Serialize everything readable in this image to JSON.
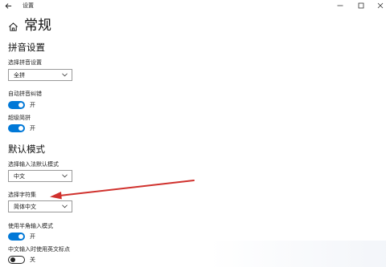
{
  "titlebar": {
    "app_title": "设置",
    "back_icon": "back-arrow-icon",
    "minimize_icon": "minimize-icon",
    "maximize_icon": "maximize-icon",
    "close_icon": "close-icon"
  },
  "header": {
    "home_icon": "home-icon",
    "title": "常规"
  },
  "pinyin_section": {
    "title": "拼音设置",
    "select_label": "选择拼音设置",
    "select_value": "全拼",
    "fuzzy_label": "自动拼音纠错",
    "fuzzy_state": "开",
    "fuzzy_on": true,
    "super_label": "超级简拼",
    "super_state": "开",
    "super_on": true
  },
  "default_section": {
    "title": "默认模式",
    "mode_label": "选择输入法默认模式",
    "mode_value": "中文",
    "charset_label": "选择字符集",
    "charset_value": "简体中文",
    "halfwidth_label": "使用半角输入模式",
    "halfwidth_state": "开",
    "halfwidth_on": true,
    "punct_label": "中文输入时使用英文标点",
    "punct_state": "关",
    "punct_on": false
  },
  "colors": {
    "toggle_on": "#0078d7",
    "annotation_arrow": "#d0312d"
  }
}
